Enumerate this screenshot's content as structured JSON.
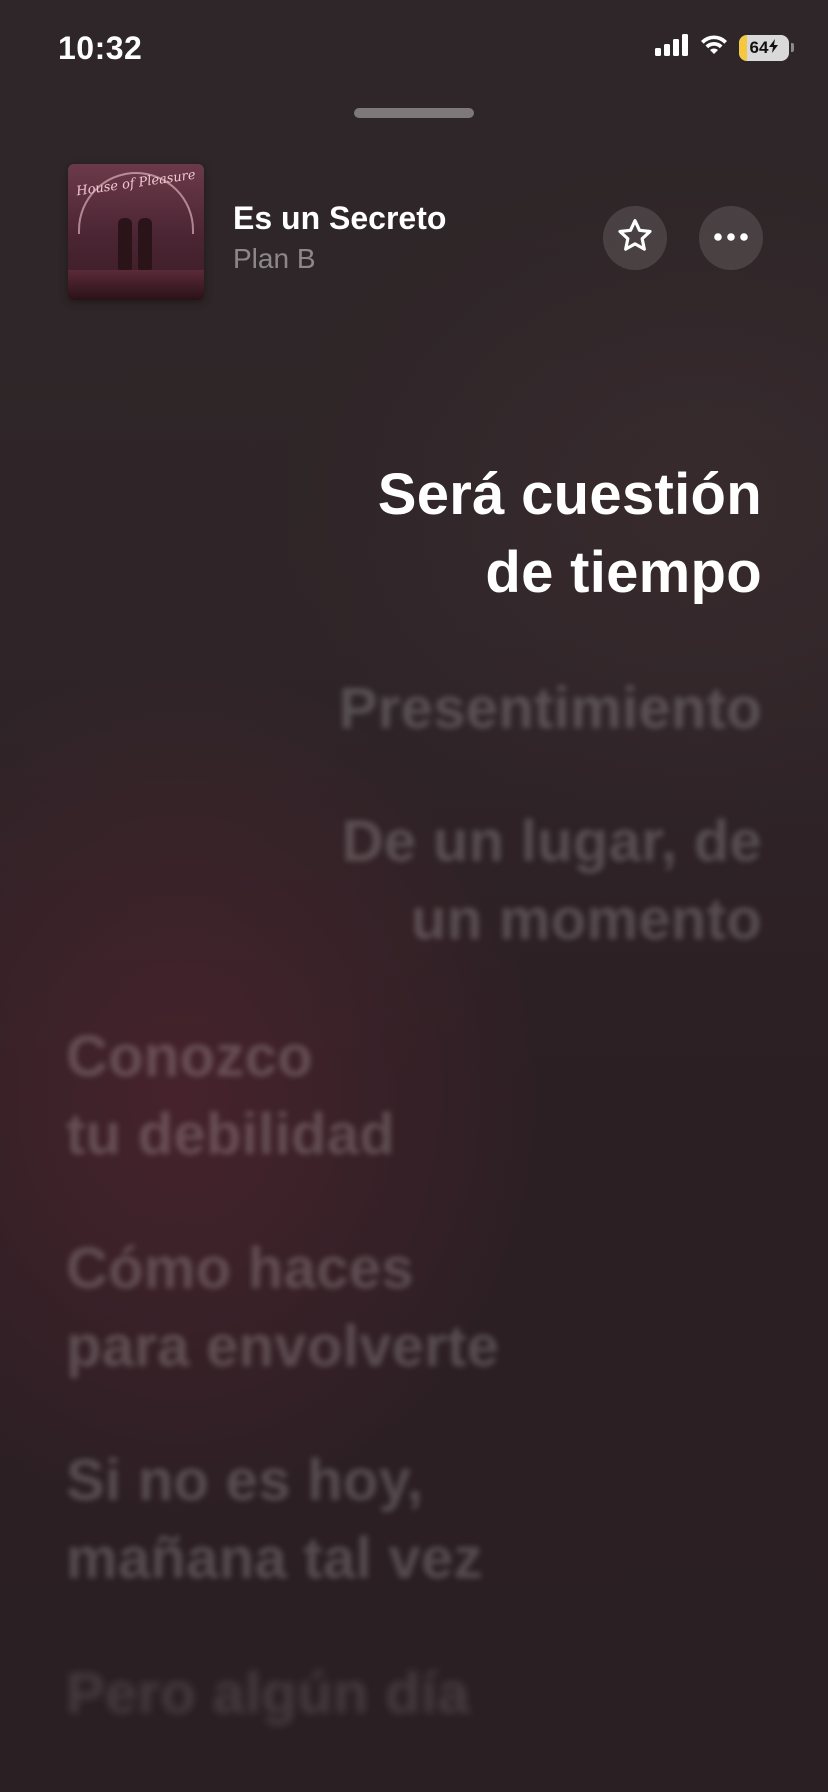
{
  "status_bar": {
    "time": "10:32",
    "battery_percent": "64"
  },
  "now_playing": {
    "artwork_title": "House of Pleasure",
    "title": "Es un Secreto",
    "artist": "Plan B",
    "favorite_icon": "star-icon",
    "more_icon": "ellipsis-icon"
  },
  "lyrics": {
    "active": [
      "Será cuestión",
      "de tiempo"
    ],
    "next_1": [
      "Presentimiento"
    ],
    "next_2": [
      "De un lugar, de",
      "un momento"
    ],
    "next_3": [
      "Conozco",
      "tu debilidad"
    ],
    "next_4": [
      "Cómo haces",
      "para envolverte"
    ],
    "next_5": [
      "Si no es hoy,",
      "mañana tal vez"
    ],
    "next_6": [
      "Pero algún día"
    ]
  },
  "colors": {
    "background": "#2b2124",
    "accent_battery": "#f5c842",
    "text_primary": "#ffffff"
  }
}
